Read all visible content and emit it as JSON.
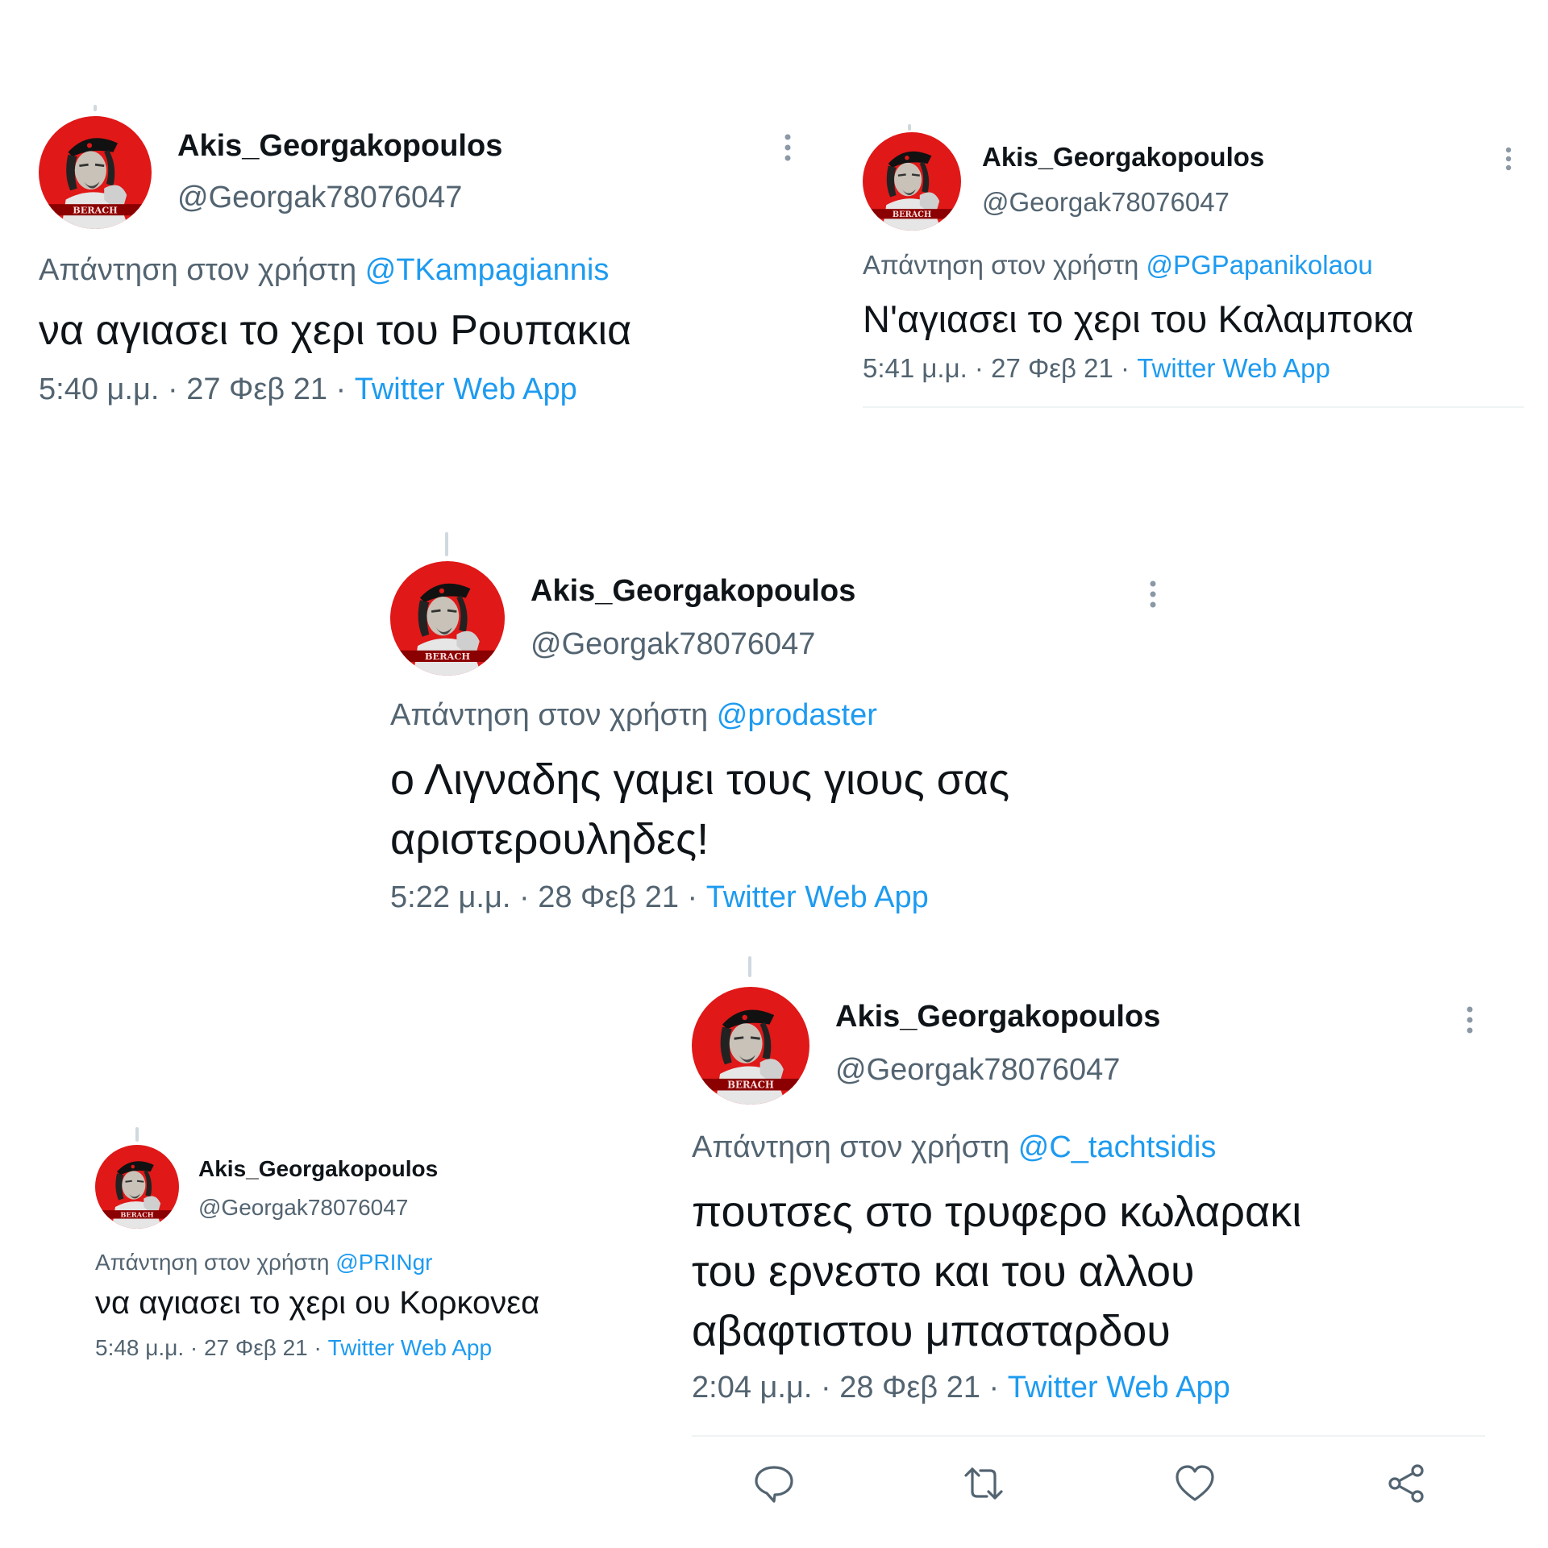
{
  "colors": {
    "text": "#0f1419",
    "secondary": "#536471",
    "link": "#1d9bf0",
    "avatar_bg": "#e01818"
  },
  "tweets": [
    {
      "display_name": "Akis_Georgakopoulos",
      "handle": "@Georgak78076047",
      "reply_prefix": "Απάντηση στον χρήστη",
      "reply_to": "@TKampagiannis",
      "text": "να αγιασει το χερι του Ρουπακια",
      "time_date": "5:40 μ.μ. · 27 Φεβ 21 ·",
      "source": "Twitter Web App",
      "avatar_icon": "profile-avatar",
      "menu_icon": "more-vertical-icon"
    },
    {
      "display_name": "Akis_Georgakopoulos",
      "handle": "@Georgak78076047",
      "reply_prefix": "Απάντηση στον χρήστη",
      "reply_to": "@PGPapanikolaou",
      "text": "Ν'αγιασει το χερι του Καλαμποκα",
      "time_date": "5:41 μ.μ. · 27 Φεβ 21 ·",
      "source": "Twitter Web App",
      "avatar_icon": "profile-avatar",
      "menu_icon": "more-vertical-icon"
    },
    {
      "display_name": "Akis_Georgakopoulos",
      "handle": "@Georgak78076047",
      "reply_prefix": "Απάντηση στον χρήστη",
      "reply_to": "@prodaster",
      "text_lines": [
        "ο Λιγναδης γαμει τους γιους σας",
        "αριστερουληδες!"
      ],
      "time_date": "5:22 μ.μ. · 28 Φεβ 21 ·",
      "source": "Twitter Web App",
      "avatar_icon": "profile-avatar",
      "menu_icon": "more-vertical-icon"
    },
    {
      "display_name": "Akis_Georgakopoulos",
      "handle": "@Georgak78076047",
      "reply_prefix": "Απάντηση στον χρήστη",
      "reply_to": "@PRINgr",
      "text": "να αγιασει το χερι ου Κορκονεα",
      "time_date": "5:48 μ.μ. · 27 Φεβ 21 ·",
      "source": "Twitter Web App",
      "avatar_icon": "profile-avatar"
    },
    {
      "display_name": "Akis_Georgakopoulos",
      "handle": "@Georgak78076047",
      "reply_prefix": "Απάντηση στον χρήστη",
      "reply_to": "@C_tachtsidis",
      "text_lines": [
        "πουτσες στο τρυφερο κωλαρακι",
        "του ερνεστο και του αλλου",
        "αβαφτιστου μπασταρδου"
      ],
      "time_date": "2:04 μ.μ. · 28 Φεβ 21 ·",
      "source": "Twitter Web App",
      "avatar_icon": "profile-avatar",
      "menu_icon": "more-vertical-icon",
      "actions": [
        "reply-icon",
        "retweet-icon",
        "like-icon",
        "share-icon"
      ]
    }
  ]
}
